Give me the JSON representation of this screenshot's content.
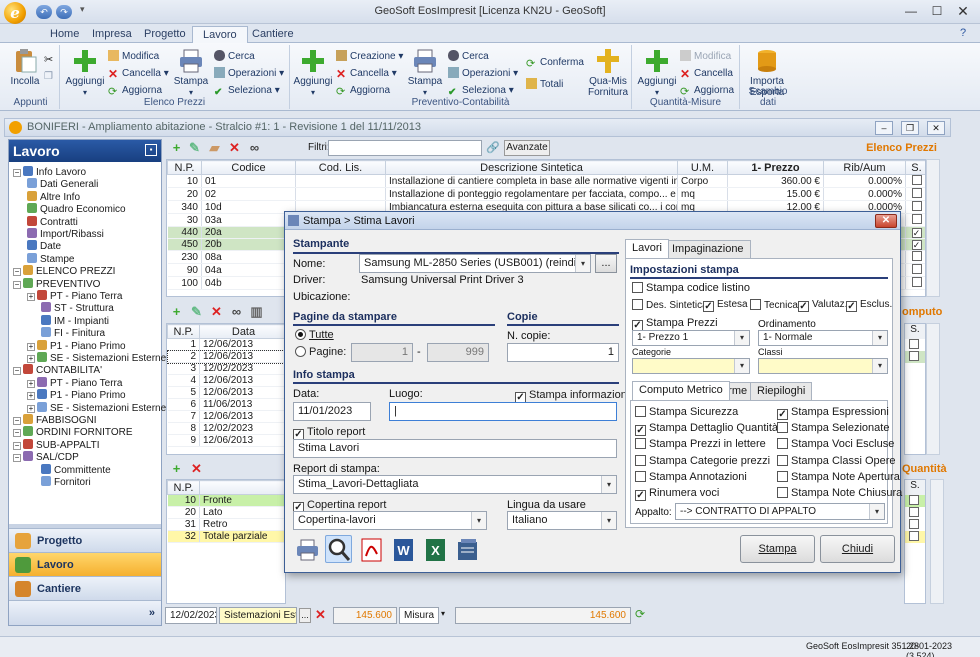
{
  "window": {
    "title": "GeoSoft EosImpresit [Licenza KN2U - GeoSoft]",
    "app_icon_letter": "e"
  },
  "ribbon_tabs": [
    "Home",
    "Impresa",
    "Progetto",
    "Lavoro",
    "Cantiere"
  ],
  "ribbon_active_tab": "Lavoro",
  "ribbon": {
    "appunti": {
      "label": "Appunti",
      "incolla": "Incolla"
    },
    "elenco_prezzi": {
      "label": "Elenco Prezzi",
      "aggiungi": "Aggiungi",
      "modifica": "Modifica",
      "cancella": "Cancella",
      "aggiorna": "Aggiorna",
      "stampa": "Stampa",
      "cerca": "Cerca",
      "operazioni": "Operazioni",
      "seleziona": "Seleziona"
    },
    "preventivo": {
      "label": "Preventivo-Contabilità",
      "aggiungi": "Aggiungi",
      "creazione": "Creazione",
      "cancella": "Cancella",
      "aggiorna": "Aggiorna",
      "stampa": "Stampa",
      "cerca": "Cerca",
      "operazioni": "Operazioni",
      "seleziona": "Seleziona",
      "conferma": "Conferma",
      "totali": "Totali",
      "qua_mis_1": "Qua-Mis",
      "qua_mis_2": "Fornitura"
    },
    "quantita": {
      "label": "Quantità-Misure",
      "aggiungi": "Aggiungi",
      "modifica": "Modifica",
      "cancella": "Cancella",
      "aggiorna": "Aggiorna"
    },
    "scambio": {
      "label": "Scambio dati",
      "importa_1": "Importa",
      "importa_2": "Esporta"
    }
  },
  "document": {
    "title": "BONIFERI - Ampliamento abitazione - Stralcio #1: 1 - Revisione 1 del 11/11/2013",
    "elenco_prezzi_label": "Elenco Prezzi",
    "computo_label": "omputo",
    "quantita_label": "Quantità"
  },
  "nav": {
    "header": "Lavoro",
    "tree": [
      {
        "label": "Info Lavoro",
        "level": 0
      },
      {
        "label": "Dati Generali",
        "level": 1
      },
      {
        "label": "Altre Info",
        "level": 1
      },
      {
        "label": "Quadro Economico",
        "level": 1
      },
      {
        "label": "Contratti",
        "level": 1
      },
      {
        "label": "Import/Ribassi",
        "level": 1
      },
      {
        "label": "Date",
        "level": 1
      },
      {
        "label": "Stampe",
        "level": 1
      },
      {
        "label": "ELENCO PREZZI",
        "level": 0
      },
      {
        "label": "PREVENTIVO",
        "level": 0
      },
      {
        "label": "PT - Piano Terra",
        "level": 1
      },
      {
        "label": "ST - Struttura",
        "level": 2
      },
      {
        "label": "IM - Impianti",
        "level": 2
      },
      {
        "label": "FI - Finitura",
        "level": 2
      },
      {
        "label": "P1 - Piano Primo",
        "level": 1
      },
      {
        "label": "SE - Sistemazioni Esterne",
        "level": 1
      },
      {
        "label": "CONTABILITA'",
        "level": 0
      },
      {
        "label": "PT - Piano Terra",
        "level": 1
      },
      {
        "label": "P1 - Piano Primo",
        "level": 1
      },
      {
        "label": "SE - Sistemazioni Esterne",
        "level": 1
      },
      {
        "label": "FABBISOGNI",
        "level": 0
      },
      {
        "label": "ORDINI FORNITORE",
        "level": 0
      },
      {
        "label": "SUB-APPALTI",
        "level": 0
      },
      {
        "label": "SAL/CDP",
        "level": 0
      },
      {
        "label": "Committente",
        "level": 2
      },
      {
        "label": "Fornitori",
        "level": 2
      }
    ],
    "buttons": [
      "Progetto",
      "Lavoro",
      "Cantiere"
    ]
  },
  "elenco": {
    "filter_label": "Filtri:",
    "avanzate": "Avanzate",
    "headers": [
      "N.P.",
      "Codice",
      "Cod. Lis.",
      "Descrizione Sintetica",
      "U.M.",
      "1- Prezzo",
      "Rib/Aum",
      "S."
    ],
    "rows": [
      {
        "np": "10",
        "codice": "01",
        "desc": "Installazione di cantiere completa in base alle normative vigenti in materia.",
        "um": "Corpo",
        "prezzo": "360.00 €",
        "rib": "0.000%",
        "s": false,
        "green": false
      },
      {
        "np": "20",
        "codice": "02",
        "desc": "Installazione di ponteggio regolamentare per facciata, compo... e realizzazione",
        "um": "mq",
        "prezzo": "15.00 €",
        "rib": "0.000%",
        "s": false,
        "green": false
      },
      {
        "np": "340",
        "codice": "10d",
        "desc": "Imbiancatura esterna eseguita con pittura a base silicati co... i cornici e balza",
        "um": "mq",
        "prezzo": "12.00 €",
        "rib": "0.000%",
        "s": false,
        "green": false
      },
      {
        "np": "30",
        "codice": "03a",
        "desc": "",
        "um": "",
        "prezzo": "",
        "rib": "",
        "s": false,
        "green": false
      },
      {
        "np": "440",
        "codice": "20a",
        "desc": "",
        "um": "",
        "prezzo": "",
        "rib": "",
        "s": true,
        "green": true
      },
      {
        "np": "450",
        "codice": "20b",
        "desc": "",
        "um": "",
        "prezzo": "",
        "rib": "",
        "s": true,
        "green": true
      },
      {
        "np": "230",
        "codice": "08a",
        "desc": "",
        "um": "",
        "prezzo": "",
        "rib": "",
        "s": false,
        "green": false
      },
      {
        "np": "90",
        "codice": "04a",
        "desc": "",
        "um": "",
        "prezzo": "",
        "rib": "",
        "s": false,
        "green": false
      },
      {
        "np": "100",
        "codice": "04b",
        "desc": "",
        "um": "",
        "prezzo": "",
        "rib": "",
        "s": false,
        "green": false
      }
    ]
  },
  "computo": {
    "headers": [
      "N.P.",
      "Data"
    ],
    "rows": [
      {
        "np": "1",
        "data": "12/06/2013"
      },
      {
        "np": "2",
        "data": "12/06/2013"
      },
      {
        "np": "3",
        "data": "12/02/2023"
      },
      {
        "np": "4",
        "data": "12/06/2013"
      },
      {
        "np": "5",
        "data": "12/06/2013"
      },
      {
        "np": "6",
        "data": "11/06/2013"
      },
      {
        "np": "7",
        "data": "12/06/2013"
      },
      {
        "np": "8",
        "data": "12/02/2023"
      },
      {
        "np": "9",
        "data": "12/06/2013"
      }
    ]
  },
  "quantita": {
    "header": "N.P.",
    "rows": [
      {
        "np": "10",
        "desc": "Fronte",
        "green": true
      },
      {
        "np": "20",
        "desc": "Lato",
        "green": false
      },
      {
        "np": "31",
        "desc": "Retro",
        "green": false
      },
      {
        "np": "32",
        "desc": "Totale parziale",
        "green": false,
        "yellow": true
      }
    ]
  },
  "bottom": {
    "date": "12/02/2023",
    "sistemazioni": "Sistemazioni Estern",
    "value1": "145.600",
    "misura": "Misura",
    "value2": "145.600"
  },
  "dialog": {
    "title": "Stampa > Stima Lavori",
    "stampante": {
      "section": "Stampante",
      "nome_label": "Nome:",
      "nome_value": "Samsung ML-2850 Series (USB001) (reindirizzam",
      "browse": "...",
      "driver_label": "Driver:",
      "driver_value": "Samsung Universal Print Driver 3",
      "ubicazione_label": "Ubicazione:"
    },
    "pagine": {
      "section": "Pagine da stampare",
      "tutte": "Tutte",
      "pagine": "Pagine:",
      "from": "1",
      "dash": "-",
      "to": "999"
    },
    "copie": {
      "section": "Copie",
      "label": "N. copie:",
      "value": "1"
    },
    "info": {
      "section": "Info stampa",
      "data_label": "Data:",
      "data_value": "11/01/2023",
      "luogo_label": "Luogo:",
      "luogo_value": "",
      "stampa_info": "Stampa informazioni",
      "titolo_report": "Titolo report",
      "titolo_value": "Stima Lavori",
      "report_label": "Report di stampa:",
      "report_value": "Stima_Lavori-Dettagliata",
      "copertina": "Copertina report",
      "copertina_value": "Copertina-lavori",
      "lingua_label": "Lingua da usare",
      "lingua_value": "Italiano"
    },
    "tabs": [
      "Lavori",
      "Impaginazione"
    ],
    "impostazioni": {
      "section": "Impostazioni stampa",
      "stampa_codice": "Stampa codice listino",
      "des_sintetica": "Des. Sintetica",
      "estesa": "Estesa",
      "tecnica": "Tecnica",
      "valutaz": "Valutaz.",
      "esclus": "Esclus.",
      "stampa_prezzi": "Stampa Prezzi",
      "ordinamento": "Ordinamento",
      "prezzo_value": "1- Prezzo 1",
      "ordinamento_value": "1- Normale",
      "categorie": "Categorie",
      "classi": "Classi"
    },
    "subtabs": [
      "Computo Metrico",
      "Firme",
      "Riepiloghi"
    ],
    "options_left": [
      {
        "label": "Stampa Sicurezza",
        "checked": false
      },
      {
        "label": "Stampa Dettaglio Quantità",
        "checked": true
      },
      {
        "label": "Stampa Prezzi in lettere",
        "checked": false
      },
      {
        "label": "Stampa Categorie prezzi",
        "checked": false
      },
      {
        "label": "Stampa Annotazioni",
        "checked": false
      },
      {
        "label": "Rinumera voci",
        "checked": true
      }
    ],
    "options_right": [
      {
        "label": "Stampa Espressioni",
        "checked": true
      },
      {
        "label": "Stampa Selezionate",
        "checked": false
      },
      {
        "label": "Stampa Voci Escluse",
        "checked": false
      },
      {
        "label": "Stampa Classi Opere",
        "checked": false
      },
      {
        "label": "Stampa Note Apertura",
        "checked": false
      },
      {
        "label": "Stampa Note Chiusura",
        "checked": false
      }
    ],
    "appalto_label": "Appalto:",
    "appalto_value": "--> CONTRATTO DI APPALTO",
    "btn_stampa": "Stampa",
    "btn_chiudi": "Chiudi"
  },
  "status": {
    "version": "GeoSoft EosImpresit 351.28",
    "date": "20-01-2023 (3.524)"
  }
}
